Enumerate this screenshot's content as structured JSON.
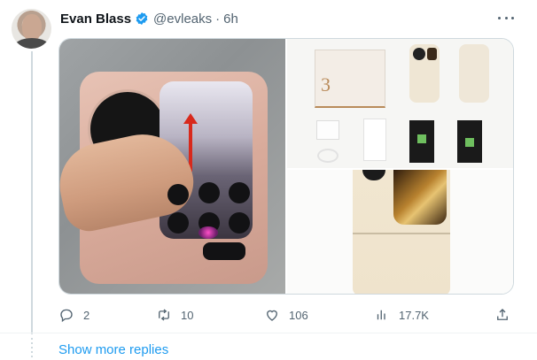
{
  "tweet": {
    "author_name": "Evan Blass",
    "handle": "@evleaks",
    "separator": "·",
    "time": "6h",
    "verified_color": "#1d9bf0"
  },
  "media": {
    "box_numeral": "3"
  },
  "actions": {
    "reply_count": "2",
    "retweet_count": "10",
    "like_count": "106",
    "view_count": "17.7K"
  },
  "thread": {
    "show_more_label": "Show more replies"
  },
  "icons": {
    "more": "more-horizontal-icon",
    "reply": "reply-icon",
    "retweet": "retweet-icon",
    "like": "heart-icon",
    "views": "bar-chart-icon",
    "share": "share-icon"
  }
}
